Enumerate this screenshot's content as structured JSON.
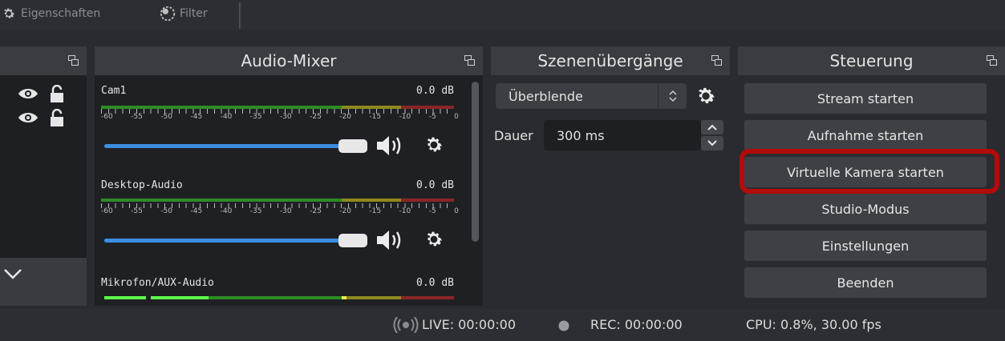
{
  "toolbar": {
    "properties_label": "Eigenschaften",
    "filter_label": "Filter"
  },
  "docks": {
    "audio_mixer_title": "Audio-Mixer",
    "transitions_title": "Szenenübergänge",
    "controls_title": "Steuerung"
  },
  "mixer": {
    "scale": [
      "-60",
      "-55",
      "-50",
      "-45",
      "-40",
      "-35",
      "-30",
      "-25",
      "-20",
      "-15",
      "-10",
      "-5",
      "0"
    ],
    "channels": [
      {
        "name": "Cam1",
        "db": "0.0 dB"
      },
      {
        "name": "Desktop-Audio",
        "db": "0.0 dB"
      },
      {
        "name": "Mikrofon/AUX-Audio",
        "db": "0.0 dB"
      }
    ]
  },
  "transitions": {
    "selected": "Überblende",
    "duration_label": "Dauer",
    "duration_value": "300 ms"
  },
  "controls": {
    "buttons": [
      "Stream starten",
      "Aufnahme starten",
      "Virtuelle Kamera starten",
      "Studio-Modus",
      "Einstellungen",
      "Beenden"
    ]
  },
  "status": {
    "live": "LIVE: 00:00:00",
    "rec": "REC: 00:00:00",
    "cpu": "CPU: 0.8%, 30.00 fps"
  },
  "colors": {
    "accent_blue": "#3c8de0",
    "highlight_red": "#b30b0b"
  }
}
